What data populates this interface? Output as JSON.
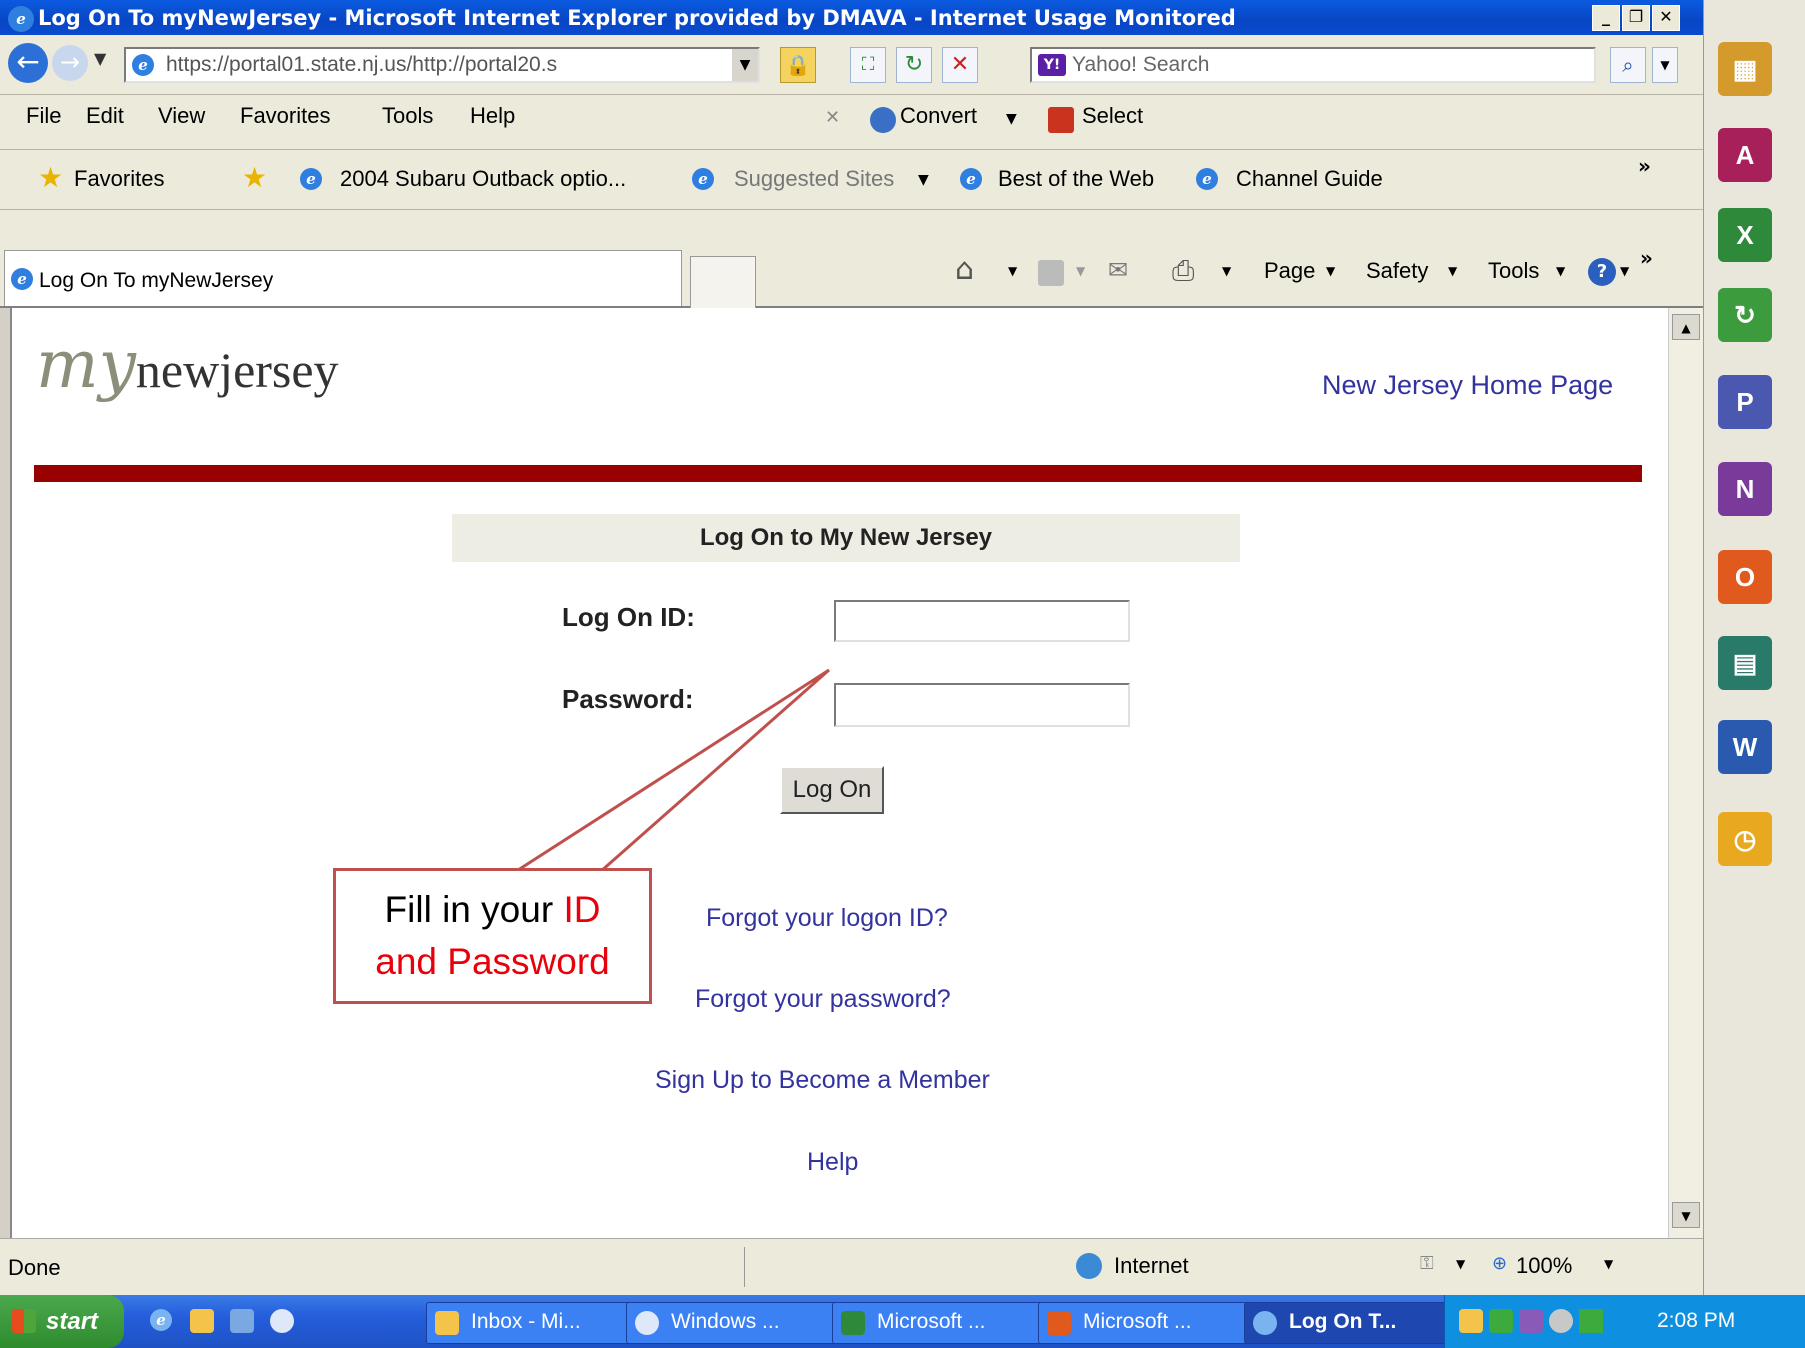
{
  "window": {
    "title": "Log On To myNewJersey - Microsoft Internet Explorer provided by DMAVA - Internet Usage Monitored"
  },
  "address_bar": {
    "url": "https://portal01.state.nj.us/http://portal20.s",
    "search_placeholder": "Yahoo! Search"
  },
  "menu": {
    "items": [
      "File",
      "Edit",
      "View",
      "Favorites",
      "Tools",
      "Help"
    ],
    "convert_label": "Convert",
    "select_label": "Select"
  },
  "favorites_bar": {
    "favorites_label": "Favorites",
    "links": [
      "2004 Subaru Outback optio...",
      "Suggested Sites",
      "Best of the Web",
      "Channel Guide"
    ]
  },
  "tab_bar": {
    "active_tab": "Log On To myNewJersey",
    "commands": [
      "Page",
      "Safety",
      "Tools"
    ]
  },
  "page": {
    "logo_script": "my",
    "logo_text": "newjersey",
    "home_link": "New Jersey Home Page",
    "login_header": "Log On to My New Jersey",
    "logon_id_label": "Log On ID:",
    "password_label": "Password:",
    "logon_id_value": "",
    "password_value": "",
    "logon_button": "Log On",
    "forgot_id": "Forgot your logon ID?",
    "forgot_password": "Forgot your password?",
    "sign_up": "Sign Up to Become a Member",
    "help": "Help"
  },
  "callout": {
    "text_part1": "Fill in your ",
    "text_highlight1": "ID",
    "text_highlight2": "and Password",
    "highlight_color": "#e8000b",
    "border_color": "#c0504d"
  },
  "status_bar": {
    "status": "Done",
    "zone": "Internet",
    "zoom": "100%"
  },
  "taskbar": {
    "start_label": "start",
    "tasks": [
      "Inbox - Mi...",
      "Windows ...",
      "Microsoft ...",
      "Microsoft ...",
      "Log On T..."
    ],
    "clock": "2:08 PM"
  },
  "colors": {
    "brand_bar": "#990000",
    "link": "#3333a0",
    "login_header_bg": "#eeede4"
  }
}
